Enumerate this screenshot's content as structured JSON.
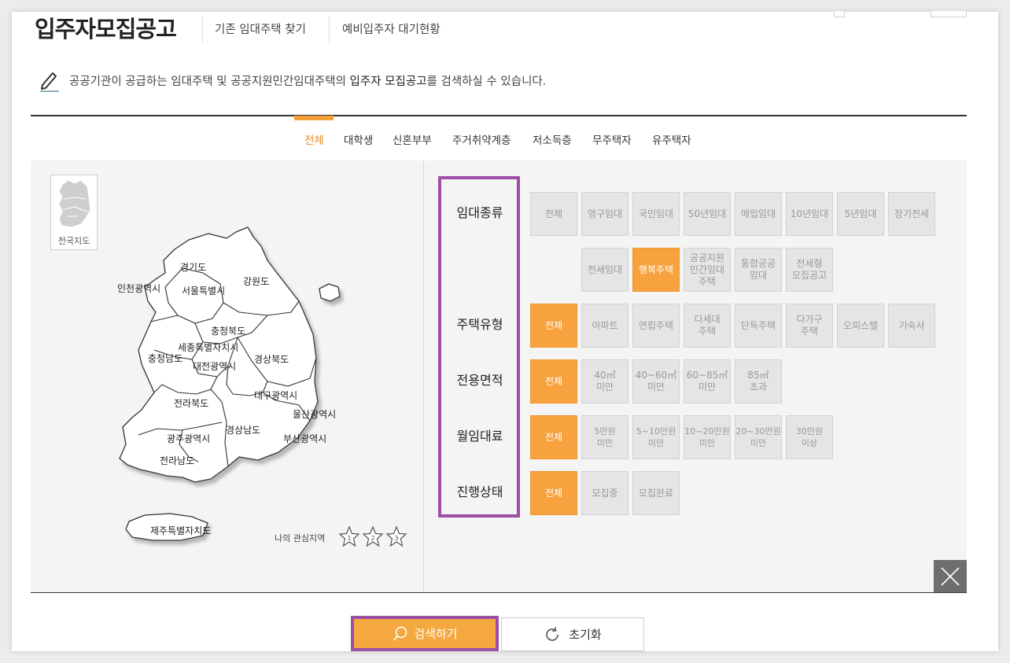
{
  "header": {
    "title": "입주자모집공고",
    "links": [
      "기존 임대주택 찾기",
      "예비입주자 대기현황"
    ]
  },
  "description": {
    "prefix": "공공기관이 공급하는 임대주택 및 공공지원민간임대주택의 ",
    "highlight": "입주자 모집공고",
    "suffix": "를 검색하실 수 있습니다."
  },
  "tabs": [
    "전체",
    "대학생",
    "신혼부부",
    "주거취약계층",
    "저소득층",
    "무주택자",
    "유주택자"
  ],
  "active_tab": "전체",
  "map": {
    "nationwide_label": "전국지도",
    "regions": [
      "경기도",
      "인천광역시",
      "서울특별시",
      "강원도",
      "충청북도",
      "세종특별자치시",
      "충청남도",
      "대전광역시",
      "경상북도",
      "대구광역시",
      "전라북도",
      "울산광역시",
      "경상남도",
      "광주광역시",
      "부산광역시",
      "전라남도",
      "제주특별자치도"
    ],
    "interest_label": "나의 관심지역",
    "stars": [
      "1",
      "2",
      "3"
    ]
  },
  "filters": {
    "rental_type": {
      "label": "임대종류",
      "options": [
        "전체",
        "영구임대",
        "국민임대",
        "50년임대",
        "매입임대",
        "10년임대",
        "5년임대",
        "장기전세",
        "전세임대",
        "행복주택",
        "공공지원\n민간임대\n주택",
        "통합공공\n임대",
        "전세형\n모집공고"
      ],
      "selected": "행복주택"
    },
    "housing_type": {
      "label": "주택유형",
      "options": [
        "전체",
        "아파트",
        "연립주택",
        "다세대\n주택",
        "단독주택",
        "다가구\n주택",
        "오피스텔",
        "기숙사"
      ],
      "selected": "전체"
    },
    "area": {
      "label": "전용면적",
      "options": [
        "전체",
        "40㎡\n미만",
        "40~60㎡\n미만",
        "60~85㎡\n미만",
        "85㎡\n초과"
      ],
      "selected": "전체"
    },
    "rent": {
      "label": "월임대료",
      "options": [
        "전체",
        "5만원\n미만",
        "5~10만원\n미만",
        "10~20만원\n미만",
        "20~30만원\n미만",
        "30만원\n이상"
      ],
      "selected": "전체"
    },
    "status": {
      "label": "진행상태",
      "options": [
        "전체",
        "모집중",
        "모집완료"
      ],
      "selected": "전체"
    }
  },
  "buttons": {
    "search": "검색하기",
    "reset": "초기화"
  },
  "colors": {
    "accent": "#f7a23e",
    "highlight_box": "#9b4fa5",
    "panel_bg": "#f4f4f4"
  }
}
